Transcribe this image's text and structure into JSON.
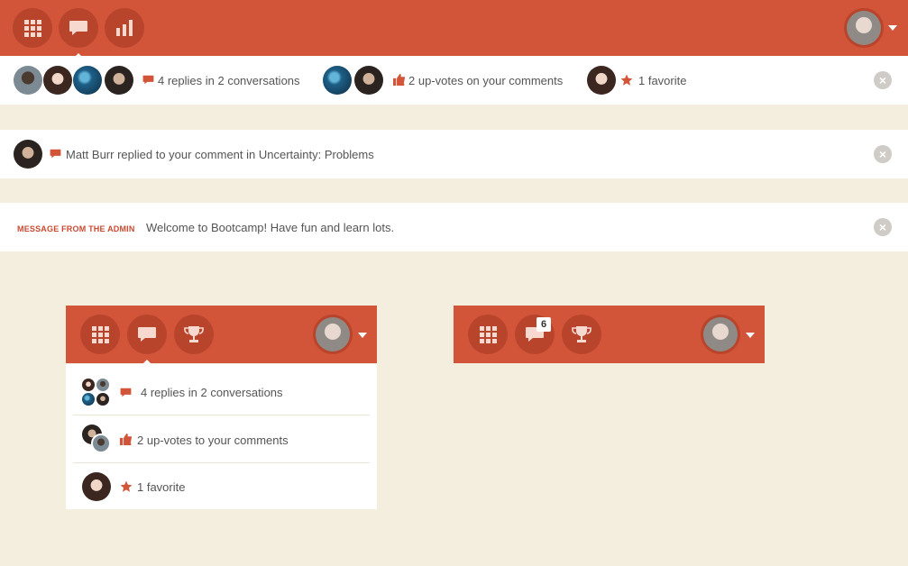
{
  "colors": {
    "accent": "#d2553a",
    "accent_dark": "#b9442c",
    "background": "#f3eedd",
    "admin_label": "#c84a30"
  },
  "top_notifications": {
    "replies_text": "4 replies in 2 conversations",
    "upvotes_text": "2 up-votes on your comments",
    "favorite_text": "1 favorite"
  },
  "reply_notification": {
    "text": "Matt Burr replied to your comment in Uncertainty: Problems"
  },
  "admin_message": {
    "label": "MESSAGE FROM THE ADMIN",
    "text": "Welcome to Bootcamp! Have fun and learn lots."
  },
  "dropdown": {
    "items": [
      {
        "text": "4 replies in 2 conversations",
        "icon": "speech-bubble-icon"
      },
      {
        "text": "2 up-votes to your comments",
        "icon": "thumbs-up-icon"
      },
      {
        "text": "1 favorite",
        "icon": "star-icon"
      }
    ]
  },
  "mini_bar": {
    "notification_count": "6"
  },
  "icons": {
    "apps": "grid-icon",
    "messages": "speech-bubble-icon",
    "stats": "bar-chart-icon",
    "achievements": "trophy-icon",
    "close": "close-icon"
  }
}
